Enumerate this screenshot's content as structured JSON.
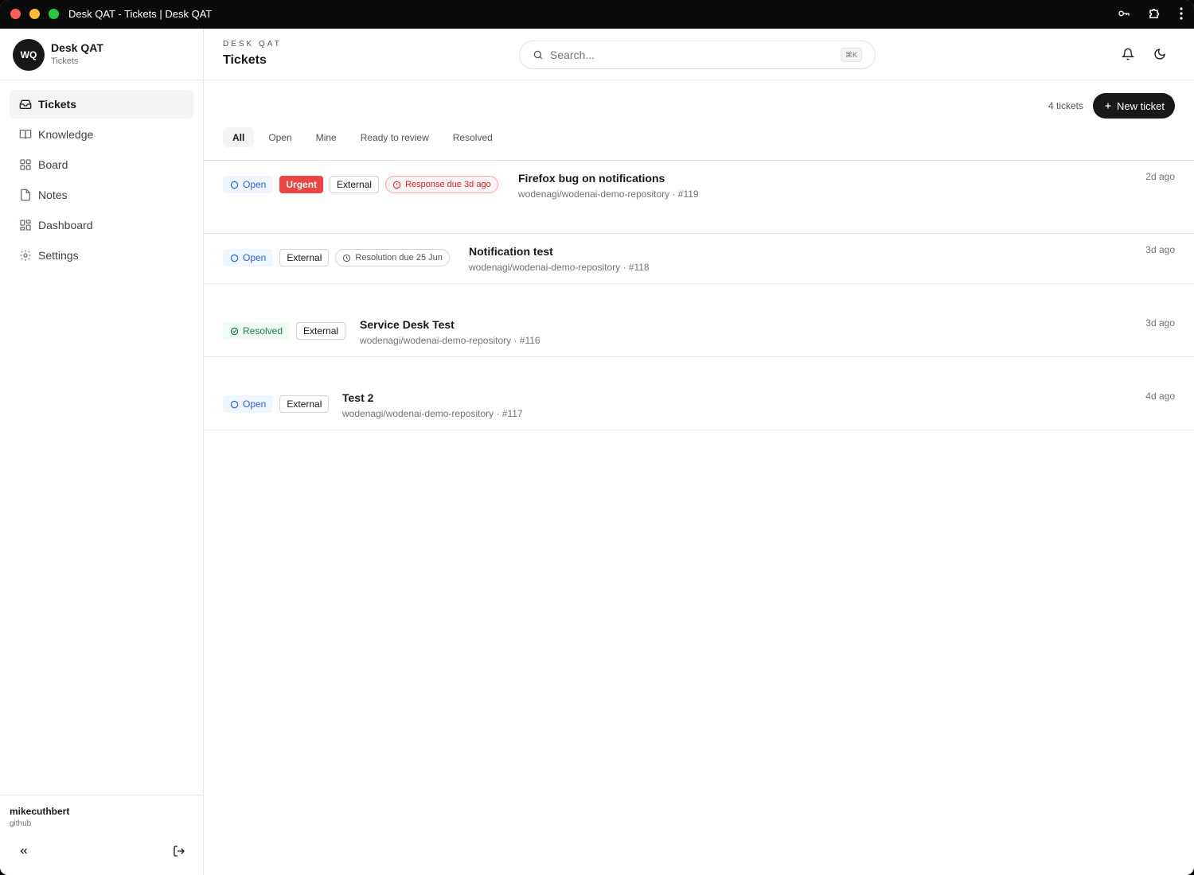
{
  "window": {
    "title": "Desk QAT - Tickets | Desk QAT"
  },
  "sidebar": {
    "brand_initials": "WQ",
    "brand_name": "Desk QAT",
    "brand_sub": "Tickets",
    "items": [
      {
        "label": "Tickets",
        "icon": "inbox-icon",
        "active": true
      },
      {
        "label": "Knowledge",
        "icon": "book-icon"
      },
      {
        "label": "Board",
        "icon": "grid-icon"
      },
      {
        "label": "Notes",
        "icon": "file-icon"
      },
      {
        "label": "Dashboard",
        "icon": "dashboard-icon"
      },
      {
        "label": "Settings",
        "icon": "gear-icon"
      }
    ],
    "user": {
      "name": "mikecuthbert",
      "provider": "github"
    }
  },
  "header": {
    "eyebrow": "DESK QAT",
    "title": "Tickets",
    "search_placeholder": "Search...",
    "search_shortcut": "⌘K"
  },
  "toolbar": {
    "count": "4 tickets",
    "new_button": "New ticket",
    "tabs": [
      "All",
      "Open",
      "Mine",
      "Ready to review",
      "Resolved"
    ],
    "active_tab": "All"
  },
  "tickets": [
    {
      "status": "Open",
      "priority": "Urgent",
      "type": "External",
      "due": "Response due 3d ago",
      "title": "Firefox bug on notifications",
      "meta": "wodenagi/wodenai-demo-repository · #119",
      "time": "2d ago"
    },
    {
      "status": "Open",
      "type": "External",
      "due": "Resolution due 25 Jun",
      "title": "Notification test",
      "meta": "wodenagi/wodenai-demo-repository · #118",
      "time": "3d ago"
    },
    {
      "status": "Resolved",
      "type": "External",
      "title": "Service Desk Test",
      "meta": "wodenagi/wodenai-demo-repository · #116",
      "time": "3d ago"
    },
    {
      "status": "Open",
      "type": "External",
      "title": "Test 2",
      "meta": "wodenagi/wodenai-demo-repository · #117",
      "time": "4d ago"
    }
  ],
  "colors": {
    "accent": "#18181b",
    "open": "#2563eb",
    "resolved": "#15803d",
    "urgent": "#ef4444",
    "titlebar": "#0b0b0b"
  }
}
